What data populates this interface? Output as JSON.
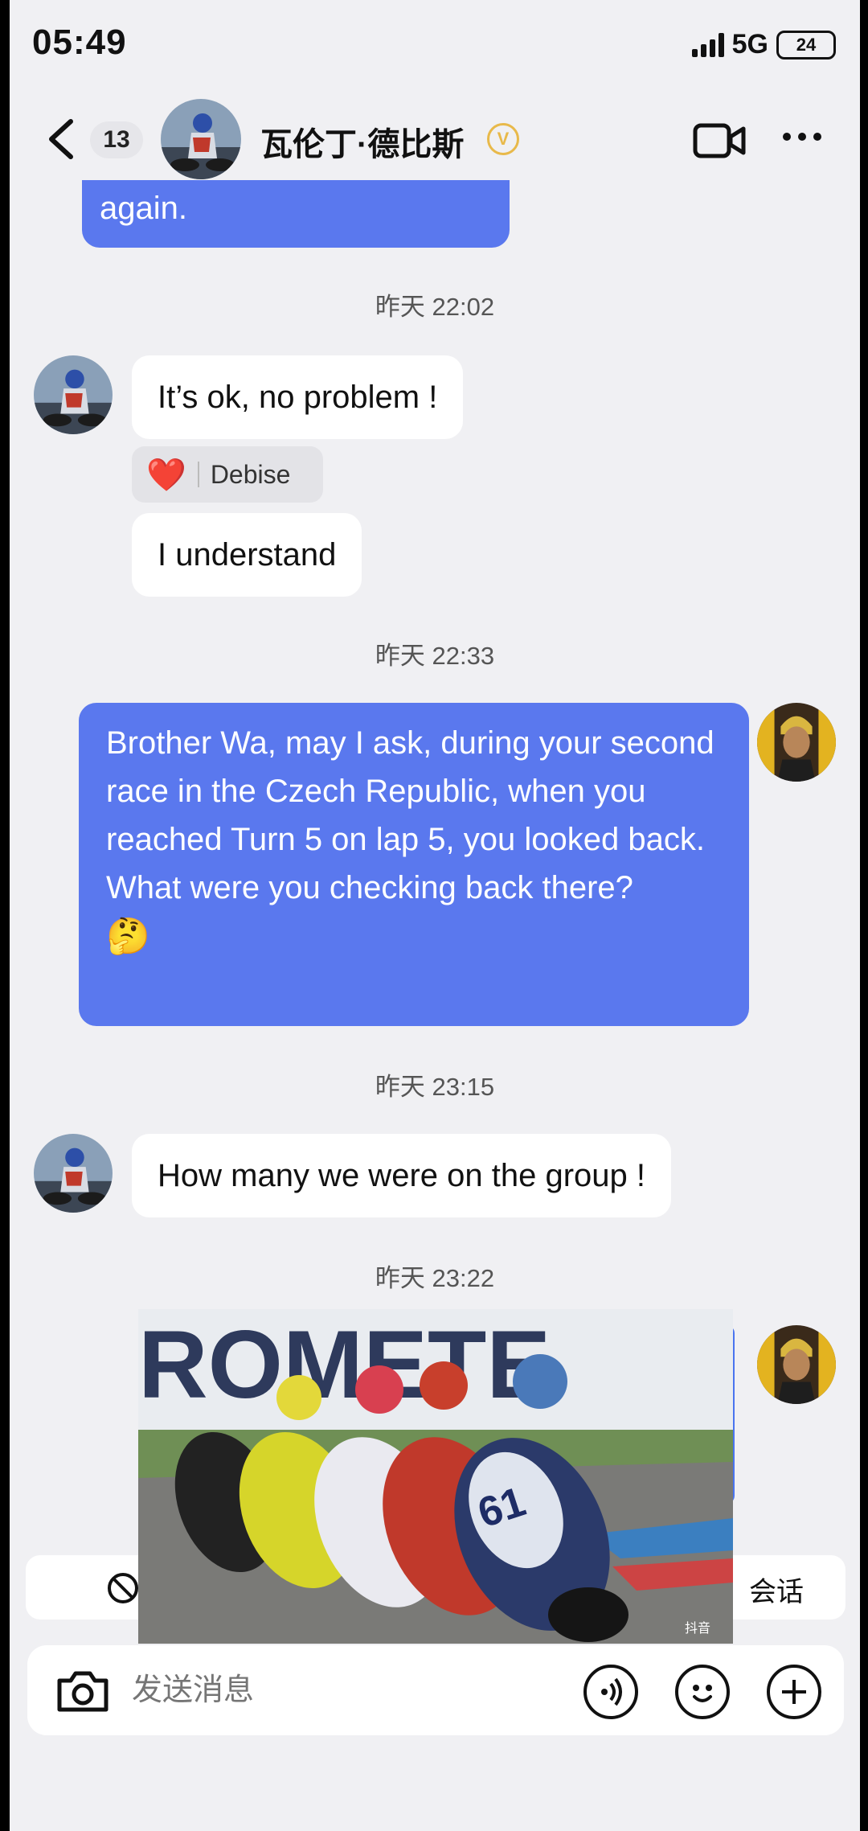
{
  "status": {
    "time": "05:49",
    "network": "5G",
    "battery": "24"
  },
  "header": {
    "unread_count": "13",
    "contact_name": "瓦伦丁·德比斯",
    "verified_mark": "V",
    "icons": [
      "back-chevron-icon",
      "video-call-icon",
      "more-icon"
    ]
  },
  "messages": {
    "partial_out": "again.",
    "ts1": "昨天 22:02",
    "in1": "It’s ok, no problem !",
    "reaction": {
      "emoji": "❤️",
      "name": "Debise"
    },
    "in2": "I understand",
    "ts2": "昨天 22:33",
    "out1": "Brother Wa, may I ask, during your second race in the Czech Republic, when you reached Turn 5 on lap 5, you looked back. What were you checking back there?",
    "out1_emoji": "🤔",
    "ts3": "昨天 23:15",
    "in3": "How many we were on the group !",
    "ts4": "昨天 23:22",
    "video": {
      "banner_text": "ROMETE",
      "rider_number": "61",
      "watermark": "抖音"
    }
  },
  "banner": {
    "text": "会话"
  },
  "composer": {
    "placeholder": "发送消息"
  },
  "colors": {
    "out_bubble": "#5a78ee",
    "in_bubble": "#ffffff",
    "background": "#f0f0f3",
    "verified": "#e8b94a"
  }
}
